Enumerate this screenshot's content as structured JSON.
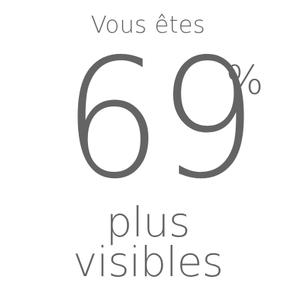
{
  "stat": {
    "prefix": "Vous êtes",
    "value": "69",
    "unit": "%",
    "suffix_line1": "plus",
    "suffix_line2": "visibles"
  },
  "colors": {
    "text": "#646464",
    "background": "#ffffff"
  }
}
